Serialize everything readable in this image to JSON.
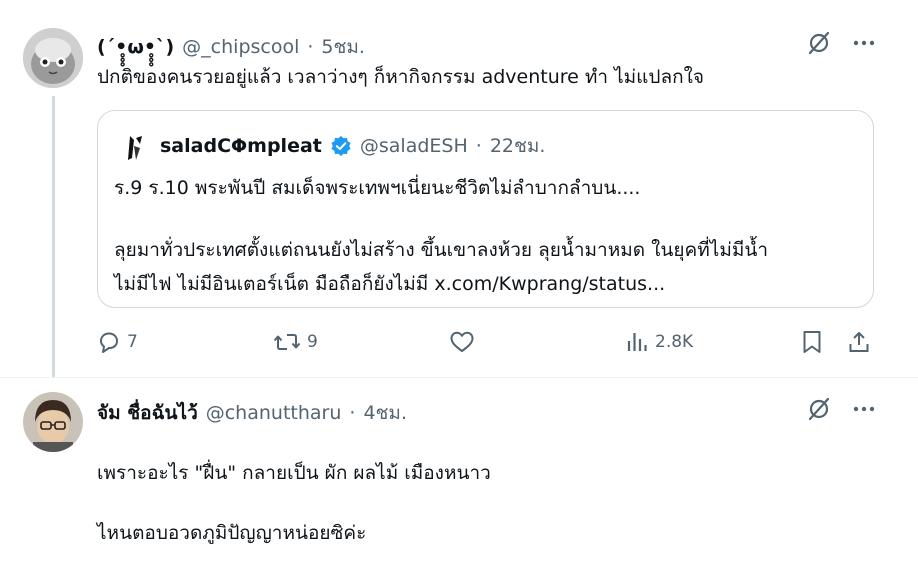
{
  "tweet1": {
    "display_name": "(´•̥̥̥ω•̥̥̥`)",
    "handle": "@_chipscool",
    "separator": "·",
    "time": "5ชม.",
    "text": "ปกติของคนรวยอยู่แล้ว เวลาว่างๆ ก็หากิจกรรม adventure ทำ ไม่แปลกใจ",
    "quote": {
      "display_name": "saladCΦmpleat",
      "handle": "@saladESH",
      "separator": "·",
      "time": "22ชม.",
      "line1": "ร.9 ร.10 พระพันปี สมเด็จพระเทพฯเนี่ยนะชีวิตไม่ลำบากลำบน....",
      "line2": "ลุยมาทั่วประเทศตั้งแต่ถนนยังไม่สร้าง ขึ้นเขาลงห้วย ลุยน้ำมาหมด ในยุคที่ไม่มีน้ำ",
      "line3": "ไม่มีไฟ ไม่มีอินเตอร์เน็ต มือถือก็ยังไม่มี x.com/Kwprang/status..."
    },
    "actions": {
      "replies": "7",
      "reposts": "9",
      "likes": "",
      "views": "2.8K"
    }
  },
  "tweet2": {
    "display_name": "จัม ชื่อฉันไว้",
    "handle": "@chanuttharu",
    "separator": "·",
    "time": "4ชม.",
    "text_line1": "เพราะอะไร \"ฝื่น\" กลายเป็น ผัก ผลไม้ เมืองหนาว",
    "text_line2": "ไหนตอบอวดภูมิปัญญาหน่อยซิค่ะ"
  },
  "colors": {
    "text": "#0f1419",
    "muted": "#536471",
    "border": "#cfd9de",
    "verified": "#1d9bf0"
  },
  "icons": [
    "grok-slash-icon",
    "more-icon",
    "reply-icon",
    "repost-icon",
    "like-icon",
    "views-icon",
    "bookmark-icon",
    "share-icon",
    "verified-badge-icon"
  ]
}
